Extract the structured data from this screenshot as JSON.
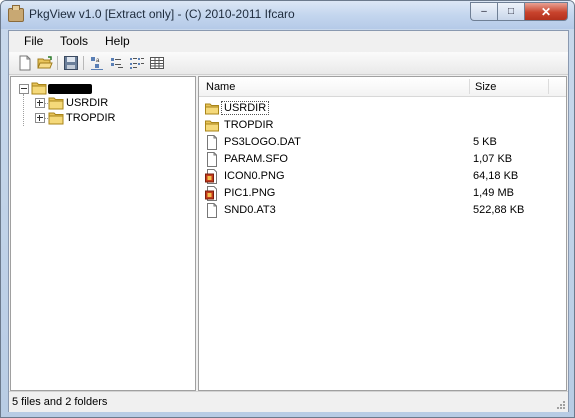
{
  "window": {
    "title": "PkgView v1.0 [Extract only] - (C) 2010-2011 Ifcaro",
    "controls": {
      "minimize": "–",
      "maximize": "□",
      "close": "✕"
    }
  },
  "menu": [
    "File",
    "Tools",
    "Help"
  ],
  "toolbar": [
    "new-icon",
    "open-folder-icon",
    "save-icon",
    "large-icons-icon",
    "small-icons-icon",
    "list-view-icon",
    "details-view-icon"
  ],
  "tree": {
    "root": {
      "label": "",
      "redacted": true
    },
    "children": [
      {
        "label": "USRDIR"
      },
      {
        "label": "TROPDIR"
      }
    ]
  },
  "list": {
    "columns": {
      "name": "Name",
      "size": "Size"
    },
    "rows": [
      {
        "name": "USRDIR",
        "size": "",
        "icon": "folder-icon"
      },
      {
        "name": "TROPDIR",
        "size": "",
        "icon": "folder-icon"
      },
      {
        "name": "PS3LOGO.DAT",
        "size": "5 KB",
        "icon": "file-icon"
      },
      {
        "name": "PARAM.SFO",
        "size": "1,07 KB",
        "icon": "file-icon"
      },
      {
        "name": "ICON0.PNG",
        "size": "64,18 KB",
        "icon": "image-icon"
      },
      {
        "name": "PIC1.PNG",
        "size": "1,49 MB",
        "icon": "image-icon"
      },
      {
        "name": "SND0.AT3",
        "size": "522,88 KB",
        "icon": "file-icon"
      }
    ]
  },
  "status": {
    "text": "5 files and 2 folders"
  },
  "colors": {
    "folder": "#e8c45a",
    "selection_focus": "#7da2ce"
  }
}
